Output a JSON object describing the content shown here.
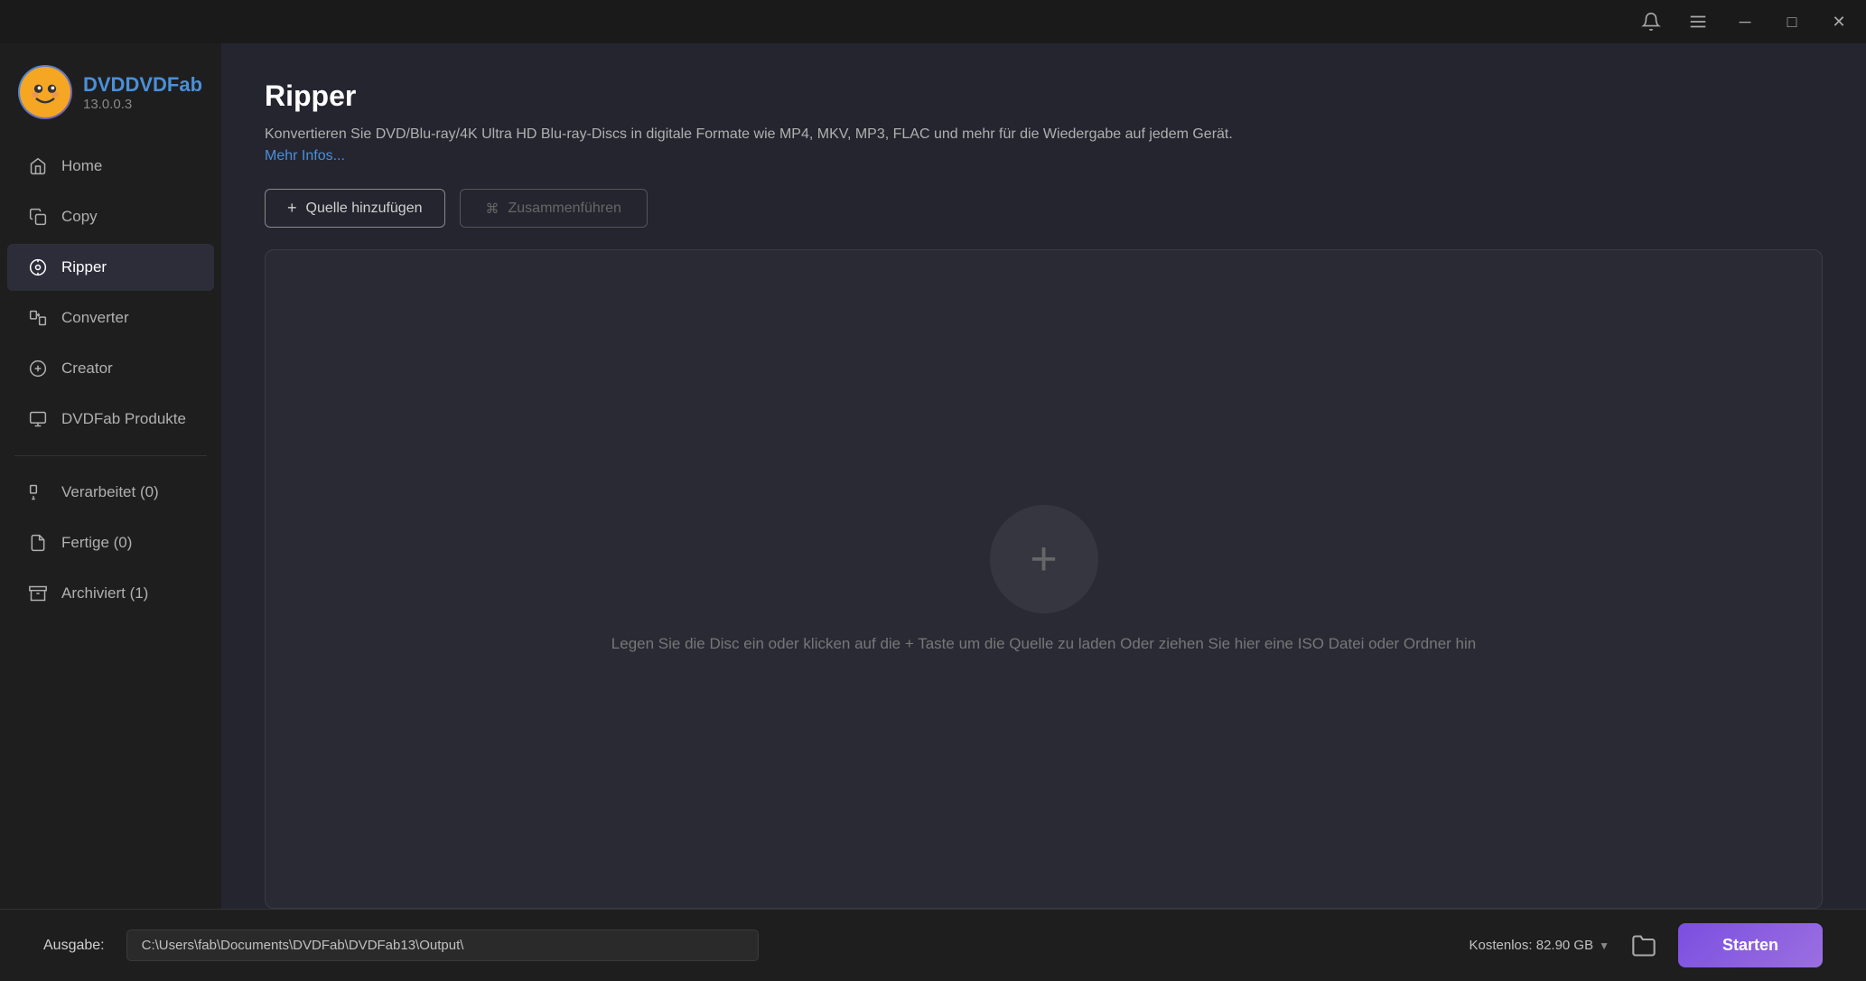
{
  "app": {
    "brand": "DVDFab",
    "version": "13.0.0.3"
  },
  "titlebar": {
    "menu_icon": "☰",
    "minimize_label": "─",
    "maximize_label": "□",
    "close_label": "✕"
  },
  "sidebar": {
    "nav_items": [
      {
        "id": "home",
        "label": "Home",
        "icon": "home"
      },
      {
        "id": "copy",
        "label": "Copy",
        "icon": "copy"
      },
      {
        "id": "ripper",
        "label": "Ripper",
        "icon": "ripper",
        "active": true
      },
      {
        "id": "converter",
        "label": "Converter",
        "icon": "converter"
      },
      {
        "id": "creator",
        "label": "Creator",
        "icon": "creator"
      },
      {
        "id": "dvdfab-produkte",
        "label": "DVDFab Produkte",
        "icon": "products"
      }
    ],
    "bottom_items": [
      {
        "id": "verarbeitet",
        "label": "Verarbeitet (0)",
        "icon": "processing"
      },
      {
        "id": "fertige",
        "label": "Fertige (0)",
        "icon": "finished"
      },
      {
        "id": "archiviert",
        "label": "Archiviert (1)",
        "icon": "archived"
      }
    ]
  },
  "content": {
    "page_title": "Ripper",
    "page_description": "Konvertieren Sie DVD/Blu-ray/4K Ultra HD Blu-ray-Discs in digitale Formate wie MP4, MKV, MP3, FLAC und mehr für die Wiedergabe auf jedem Gerät.",
    "more_info_link": "Mehr Infos...",
    "btn_add_source": "Quelle hinzufügen",
    "btn_merge": "Zusammenführen",
    "drop_hint": "Legen Sie die Disc ein oder klicken auf die + Taste um die Quelle zu laden Oder ziehen Sie hier eine ISO Datei oder Ordner hin"
  },
  "footer": {
    "output_label": "Ausgabe:",
    "output_path": "C:\\Users\\fab\\Documents\\DVDFab\\DVDFab13\\Output\\",
    "free_space": "Kostenlos: 82.90 GB",
    "start_button": "Starten"
  }
}
